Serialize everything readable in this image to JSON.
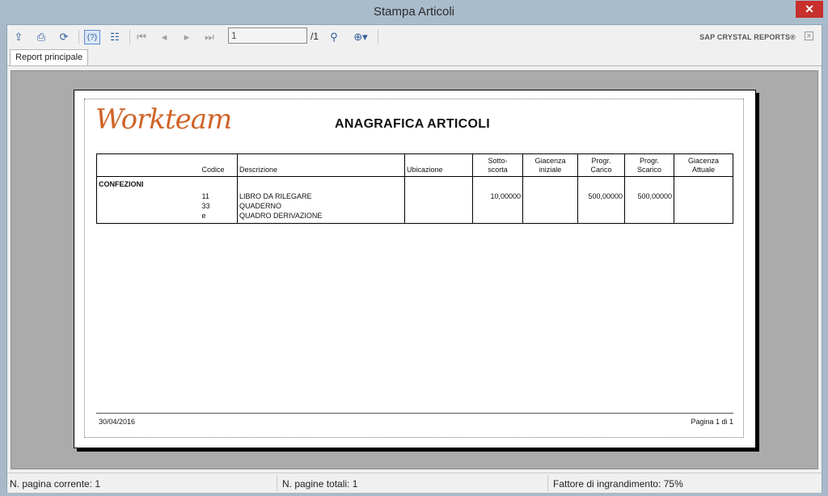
{
  "window": {
    "title": "Stampa Articoli",
    "close_glyph": "✕"
  },
  "toolbar": {
    "export_icon": "export-icon",
    "print_icon": "print-icon",
    "refresh_icon": "refresh-icon",
    "toggle_group_tree_icon": "help-icon",
    "group_tree_icon": "tree-icon",
    "page_value": "1",
    "page_total": "/1",
    "brand": "SAP CRYSTAL REPORTS®"
  },
  "tabs": [
    {
      "label": "Report principale"
    }
  ],
  "report": {
    "logo_text": "Workteam",
    "title": "ANAGRAFICA ARTICOLI",
    "columns": [
      "",
      "Codice",
      "Descrizione",
      "Ubicazione",
      "Sotto-\nscorta",
      "Giacenza\niniziale",
      "Progr.\nCarico",
      "Progr.\nScarico",
      "Giacenza\nAttuale"
    ],
    "group": "CONFEZIONI",
    "rows": [
      {
        "codice": "11",
        "descrizione": "LIBRO DA RILEGARE",
        "ubicazione": "",
        "sottoscorta": "10,00000",
        "giacenza_iniziale": "",
        "carico": "500,00000",
        "scarico": "500,00000",
        "giacenza_attuale": ""
      },
      {
        "codice": "33",
        "descrizione": "QUADERNO",
        "ubicazione": "",
        "sottoscorta": "",
        "giacenza_iniziale": "",
        "carico": "",
        "scarico": "",
        "giacenza_attuale": ""
      },
      {
        "codice": "e",
        "descrizione": "QUADRO DERIVAZIONE",
        "ubicazione": "",
        "sottoscorta": "",
        "giacenza_iniziale": "",
        "carico": "",
        "scarico": "",
        "giacenza_attuale": ""
      }
    ],
    "footer_date": "30/04/2016",
    "footer_page": "Pagina 1 di 1"
  },
  "status": {
    "current_page": "N. pagina corrente: 1",
    "total_pages": "N. pagine totali: 1",
    "zoom": "Fattore di ingrandimento: 75%"
  }
}
